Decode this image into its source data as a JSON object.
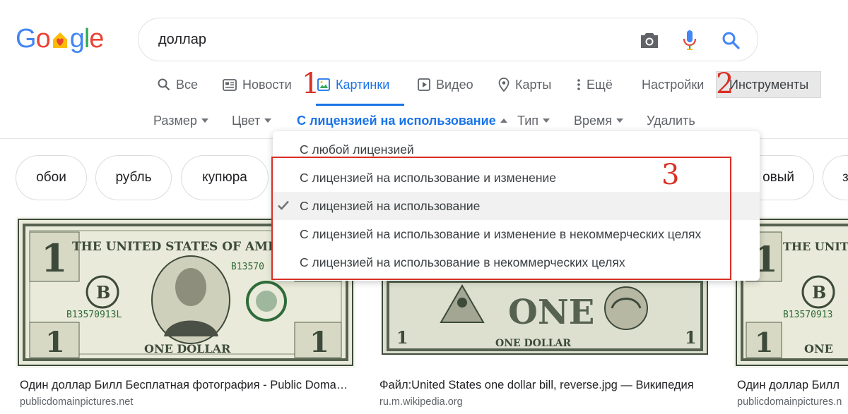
{
  "logo": {
    "letters": [
      "G",
      "o",
      "g",
      "l",
      "e"
    ]
  },
  "search": {
    "query": "доллар"
  },
  "tabs": {
    "all": "Все",
    "news": "Новости",
    "images": "Картинки",
    "video": "Видео",
    "maps": "Карты",
    "more": "Ещё",
    "settings": "Настройки",
    "tools": "Инструменты"
  },
  "annotations": {
    "one": "1",
    "two": "2",
    "three": "3"
  },
  "filters": {
    "size": "Размер",
    "color": "Цвет",
    "license": "С лицензией на использование",
    "type": "Тип",
    "time": "Время",
    "clear": "Удалить"
  },
  "license_menu": {
    "options": [
      "С любой лицензией",
      "С лицензией на использование и изменение",
      "С лицензией на использование",
      "С лицензией на использование и изменение в некоммерческих целях",
      "С лицензией на использование в некоммерческих целях"
    ],
    "selected": "С лицензией на использование"
  },
  "chips": [
    "обои",
    "рубль",
    "купюра",
    "овый",
    "з"
  ],
  "results": [
    {
      "title": "Один доллар Билл Бесплатная фотография - Public Doma…",
      "source": "publicdomainpictures.net",
      "note_text": "THE UNITED STATES OF AMERICA",
      "serial": "B13570913L",
      "bottom_text": "ONE DOLLAR"
    },
    {
      "title": "Файл:United States one dollar bill, reverse.jpg — Википедия",
      "source": "ru.m.wikipedia.org",
      "note_text": "ONE",
      "bottom_text": "ONE DOLLAR"
    },
    {
      "title": "Один доллар Билл",
      "source": "publicdomainpictures.n",
      "note_text": "THE UNITED",
      "serial": "B13570913",
      "bottom_text": "ONE"
    }
  ],
  "colors": {
    "accent": "#1a73e8",
    "annotation": "#d93025",
    "note_green": "#2f6b3a"
  }
}
